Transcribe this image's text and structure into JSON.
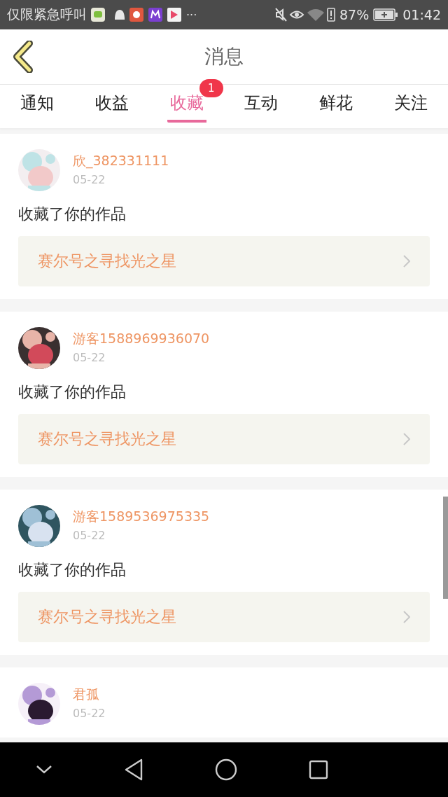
{
  "status_bar": {
    "carrier": "仅限紧急呼叫",
    "more": "···",
    "battery": "87%",
    "time": "01:42"
  },
  "header": {
    "title": "消息"
  },
  "tabs": [
    {
      "label": "通知",
      "selected": false
    },
    {
      "label": "收益",
      "selected": false
    },
    {
      "label": "收藏",
      "selected": true,
      "badge": "1"
    },
    {
      "label": "互动",
      "selected": false
    },
    {
      "label": "鲜花",
      "selected": false
    },
    {
      "label": "关注",
      "selected": false
    }
  ],
  "messages": [
    {
      "user": "欣_382331111",
      "date": "05-22",
      "text": "收藏了你的作品",
      "work": "赛尔号之寻找光之星"
    },
    {
      "user": "游客1588969936070",
      "date": "05-22",
      "text": "收藏了你的作品",
      "work": "赛尔号之寻找光之星"
    },
    {
      "user": "游客1589536975335",
      "date": "05-22",
      "text": "收藏了你的作品",
      "work": "赛尔号之寻找光之星"
    },
    {
      "user": "君孤",
      "date": "05-22"
    }
  ]
}
